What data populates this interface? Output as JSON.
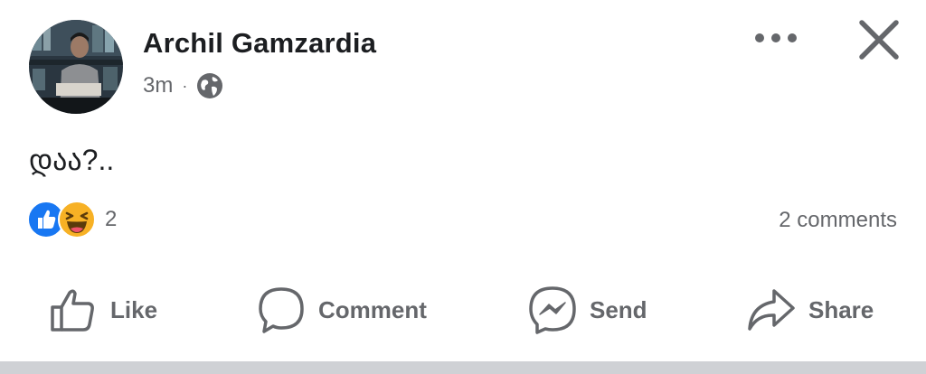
{
  "post": {
    "author": "Archil Gamzardia",
    "time": "3m",
    "separator": "·",
    "audience_icon": "globe-icon",
    "text": "დაა?..",
    "reactions": {
      "icons": [
        "like-reaction-icon",
        "haha-reaction-icon"
      ],
      "count": "2"
    },
    "comments_count": "2 comments"
  },
  "header": {
    "more_icon": "more-options-icon",
    "close_icon": "close-icon"
  },
  "actions": {
    "like": "Like",
    "comment": "Comment",
    "send": "Send",
    "share": "Share"
  },
  "colors": {
    "text_primary": "#1c1e21",
    "text_secondary": "#65676b",
    "like_blue": "#1877f2",
    "haha_yellow": "#f7b125",
    "divider": "#cfd1d5"
  }
}
